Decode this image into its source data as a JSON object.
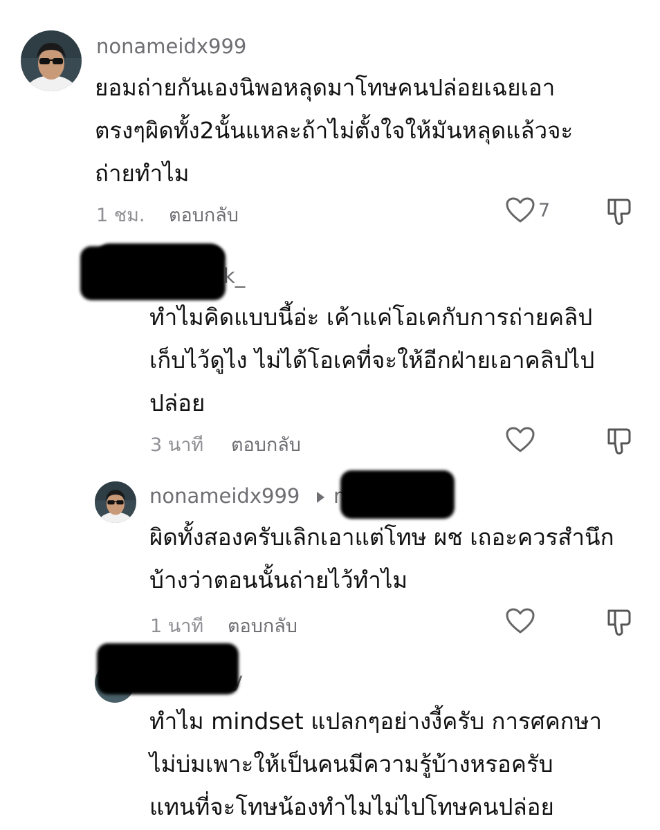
{
  "comments": [
    {
      "username": "nonameidx999",
      "lines": [
        "ยอมถ่ายกันเองนิพอหลุดมาโทษคนปล่อยเฉยเอา",
        "ตรงๆผิดทั้ง2นั้นแหละถ้าไม่ตั้งใจให้มันหลุดแล้วจะ",
        "ถ่ายทำไม"
      ],
      "time": "1 ชม.",
      "reply_label": "ตอบกลับ",
      "likes": "7"
    },
    {
      "username_partial": ".wk_",
      "lines": [
        "ทำไมคิดแบบนี้อ่ะ เค้าแค่โอเคกับการถ่ายคลิป",
        "เก็บไว้ดูไง ไม่ได้โอเคที่จะให้อีกฝ่ายเอาคลิปไป",
        "ปล่อย"
      ],
      "time": "3 นาที",
      "reply_label": "ตอบกลับ"
    },
    {
      "username": "nonameidx999",
      "reply_to_partial": "m",
      "lines": [
        "ผิดทั้งสองครับเลิกเอาแต่โทษ ผช เถอะควรสำนึก",
        "บ้างว่าตอนนั้นถ่ายไว้ทำไม"
      ],
      "time": "1 นาที",
      "reply_label": "ตอบกลับ"
    },
    {
      "username_partial": "nky",
      "lines": [
        "ทำไม mindset แปลกๆอย่างงี้ครับ การศคกษา",
        "ไม่บ่มเพาะให้เป็นคนมีความรู้บ้างหรอครับ",
        "แทนที่จะโทษน้องทำไมไม่ไปโทษคนปล่อย"
      ]
    }
  ],
  "icons": {
    "like": "heart-outline-icon",
    "dislike": "thumbs-down-icon"
  },
  "colors": {
    "text": "#111111",
    "secondary": "#6e6e73",
    "time": "#8e8e93",
    "redaction": "#000000"
  }
}
